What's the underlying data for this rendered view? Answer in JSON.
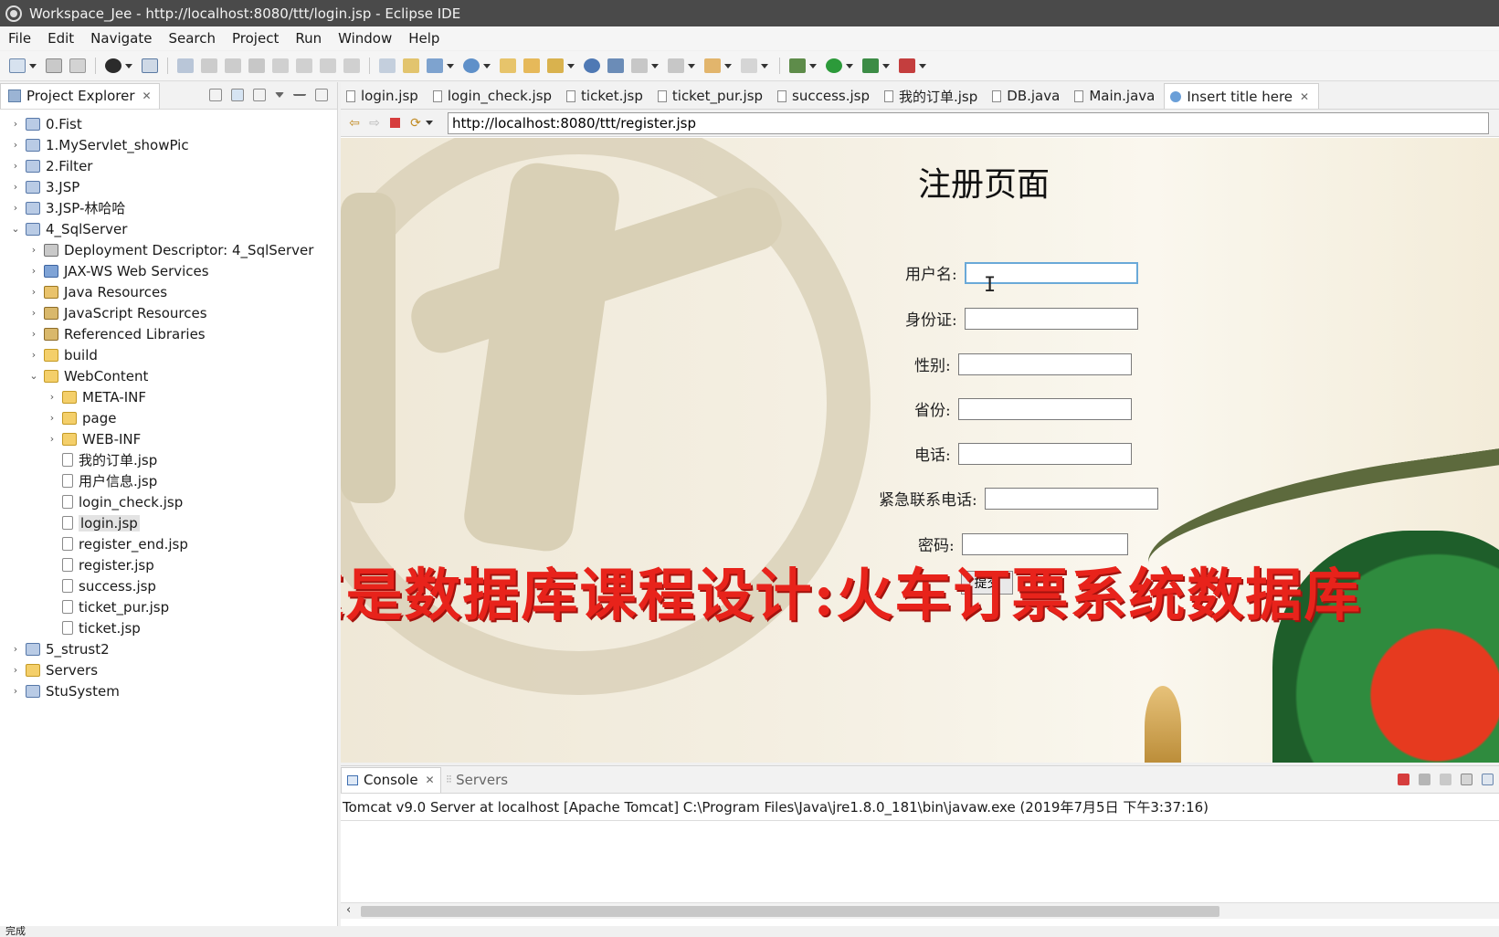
{
  "window": {
    "title": "Workspace_Jee - http://localhost:8080/ttt/login.jsp - Eclipse IDE"
  },
  "menu": [
    "File",
    "Edit",
    "Navigate",
    "Search",
    "Project",
    "Run",
    "Window",
    "Help"
  ],
  "explorer": {
    "tab_label": "Project Explorer",
    "items": [
      {
        "label": "0.Fist",
        "indent": 0,
        "expanded": false,
        "icon": "project-icon"
      },
      {
        "label": "1.MyServlet_showPic",
        "indent": 0,
        "expanded": false,
        "icon": "project-icon"
      },
      {
        "label": "2.Filter",
        "indent": 0,
        "expanded": false,
        "icon": "project-icon"
      },
      {
        "label": "3.JSP",
        "indent": 0,
        "expanded": false,
        "icon": "project-icon"
      },
      {
        "label": "3.JSP-林哈哈",
        "indent": 0,
        "expanded": false,
        "icon": "project-icon"
      },
      {
        "label": "4_SqlServer",
        "indent": 0,
        "expanded": true,
        "icon": "project-icon"
      },
      {
        "label": "Deployment Descriptor: 4_SqlServer",
        "indent": 1,
        "expanded": false,
        "icon": "descriptor-icon"
      },
      {
        "label": "JAX-WS Web Services",
        "indent": 1,
        "expanded": false,
        "icon": "webservice-icon"
      },
      {
        "label": "Java Resources",
        "indent": 1,
        "expanded": false,
        "icon": "java-resources-icon"
      },
      {
        "label": "JavaScript Resources",
        "indent": 1,
        "expanded": false,
        "icon": "library-icon"
      },
      {
        "label": "Referenced Libraries",
        "indent": 1,
        "expanded": false,
        "icon": "library-icon"
      },
      {
        "label": "build",
        "indent": 1,
        "expanded": false,
        "icon": "folder-icon"
      },
      {
        "label": "WebContent",
        "indent": 1,
        "expanded": true,
        "icon": "folder-icon"
      },
      {
        "label": "META-INF",
        "indent": 2,
        "expanded": false,
        "icon": "folder-icon"
      },
      {
        "label": "page",
        "indent": 2,
        "expanded": false,
        "icon": "folder-icon"
      },
      {
        "label": "WEB-INF",
        "indent": 2,
        "expanded": false,
        "icon": "folder-icon"
      },
      {
        "label": "我的订单.jsp",
        "indent": 2,
        "leaf": true,
        "icon": "file-icon"
      },
      {
        "label": "用户信息.jsp",
        "indent": 2,
        "leaf": true,
        "icon": "file-icon"
      },
      {
        "label": "login_check.jsp",
        "indent": 2,
        "leaf": true,
        "icon": "file-icon"
      },
      {
        "label": "login.jsp",
        "indent": 2,
        "leaf": true,
        "icon": "file-icon",
        "selected": true
      },
      {
        "label": "register_end.jsp",
        "indent": 2,
        "leaf": true,
        "icon": "file-icon"
      },
      {
        "label": "register.jsp",
        "indent": 2,
        "leaf": true,
        "icon": "file-icon"
      },
      {
        "label": "success.jsp",
        "indent": 2,
        "leaf": true,
        "icon": "file-icon"
      },
      {
        "label": "ticket_pur.jsp",
        "indent": 2,
        "leaf": true,
        "icon": "file-icon"
      },
      {
        "label": "ticket.jsp",
        "indent": 2,
        "leaf": true,
        "icon": "file-icon"
      },
      {
        "label": "5_strust2",
        "indent": 0,
        "expanded": false,
        "icon": "project-icon"
      },
      {
        "label": "Servers",
        "indent": 0,
        "expanded": false,
        "icon": "folder-icon"
      },
      {
        "label": "StuSystem",
        "indent": 0,
        "expanded": false,
        "icon": "project-icon"
      }
    ]
  },
  "editor": {
    "tabs": [
      {
        "label": "login.jsp",
        "active": false,
        "icon": "jsp-file-icon"
      },
      {
        "label": "login_check.jsp",
        "active": false,
        "icon": "jsp-file-icon"
      },
      {
        "label": "ticket.jsp",
        "active": false,
        "icon": "jsp-file-icon"
      },
      {
        "label": "ticket_pur.jsp",
        "active": false,
        "icon": "jsp-file-icon"
      },
      {
        "label": "success.jsp",
        "active": false,
        "icon": "jsp-file-icon"
      },
      {
        "label": "我的订单.jsp",
        "active": false,
        "icon": "jsp-file-icon"
      },
      {
        "label": "DB.java",
        "active": false,
        "icon": "java-file-icon"
      },
      {
        "label": "Main.java",
        "active": false,
        "icon": "java-file-icon"
      },
      {
        "label": "Insert title here",
        "active": true,
        "icon": "globe-icon"
      }
    ],
    "url": "http://localhost:8080/ttt/register.jsp"
  },
  "form": {
    "title": "注册页面",
    "username_label": "用户名:",
    "idcard_label": "身份证:",
    "gender_label": "性别:",
    "province_label": "省份:",
    "phone_label": "电话:",
    "emergency_label": "紧急联系电话:",
    "password_label": "密码:",
    "submit_label": "提交"
  },
  "overlay_caption": "这是数据库课程设计:火车订票系统数据库",
  "console": {
    "tab_label": "Console",
    "servers_tab_label": "Servers",
    "line": "Tomcat v9.0 Server at localhost [Apache Tomcat] C:\\Program Files\\Java\\jre1.8.0_181\\bin\\javaw.exe (2019年7月5日 下午3:37:16)"
  },
  "status": {
    "text": "完成"
  },
  "colors": {
    "titlebar": "#4a4a4a",
    "overlay_red": "#e8231b",
    "focus_border": "#6aa9d8",
    "stop_red": "#d63d3d"
  }
}
